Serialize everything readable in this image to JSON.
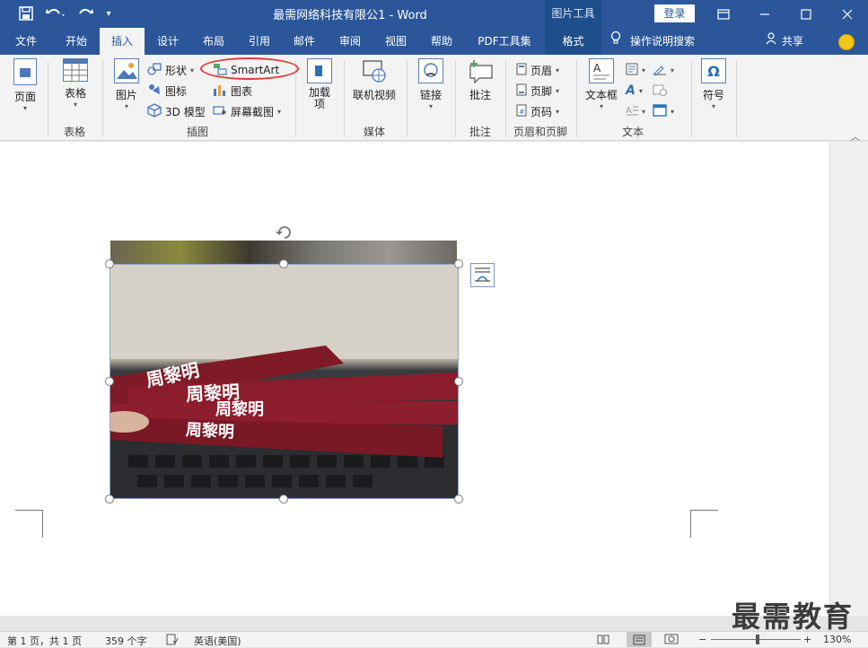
{
  "titlebar": {
    "title": "最需网络科技有限公1  -  Word",
    "picture_tools": "图片工具",
    "login": "登录"
  },
  "tabs": [
    "文件",
    "开始",
    "插入",
    "设计",
    "布局",
    "引用",
    "邮件",
    "审阅",
    "视图",
    "帮助",
    "PDF工具集",
    "格式"
  ],
  "active_tab": "插入",
  "search_label": "操作说明搜索",
  "share_label": "共享",
  "ribbon": {
    "pages": "页面",
    "table": "表格",
    "table_group": "表格",
    "picture": "图片",
    "shapes": "形状",
    "icons": "图标",
    "model3d": "3D 模型",
    "smartart": "SmartArt",
    "chart": "图表",
    "screenshot": "屏幕截图",
    "illustrations_group": "插图",
    "addins": "加载\n项",
    "online_video": "联机视频",
    "media_group": "媒体",
    "link": "链接",
    "comment": "批注",
    "comment_group": "批注",
    "header": "页眉",
    "footer": "页脚",
    "page_number": "页码",
    "header_footer_group": "页眉和页脚",
    "textbox": "文本框",
    "text_group": "文本",
    "symbol": "符号"
  },
  "photo": {
    "card_text": [
      "周黎明",
      "周黎明",
      "周黎明",
      "周黎明"
    ]
  },
  "status": {
    "page": "第 1 页，共 1 页",
    "words": "359 个字",
    "language": "英语(美国)",
    "zoom": "130%"
  },
  "watermark": "最需教育",
  "colors": {
    "word_blue": "#2b579a",
    "highlight": "#e23b3b",
    "card_red": "#8b1c2c"
  }
}
